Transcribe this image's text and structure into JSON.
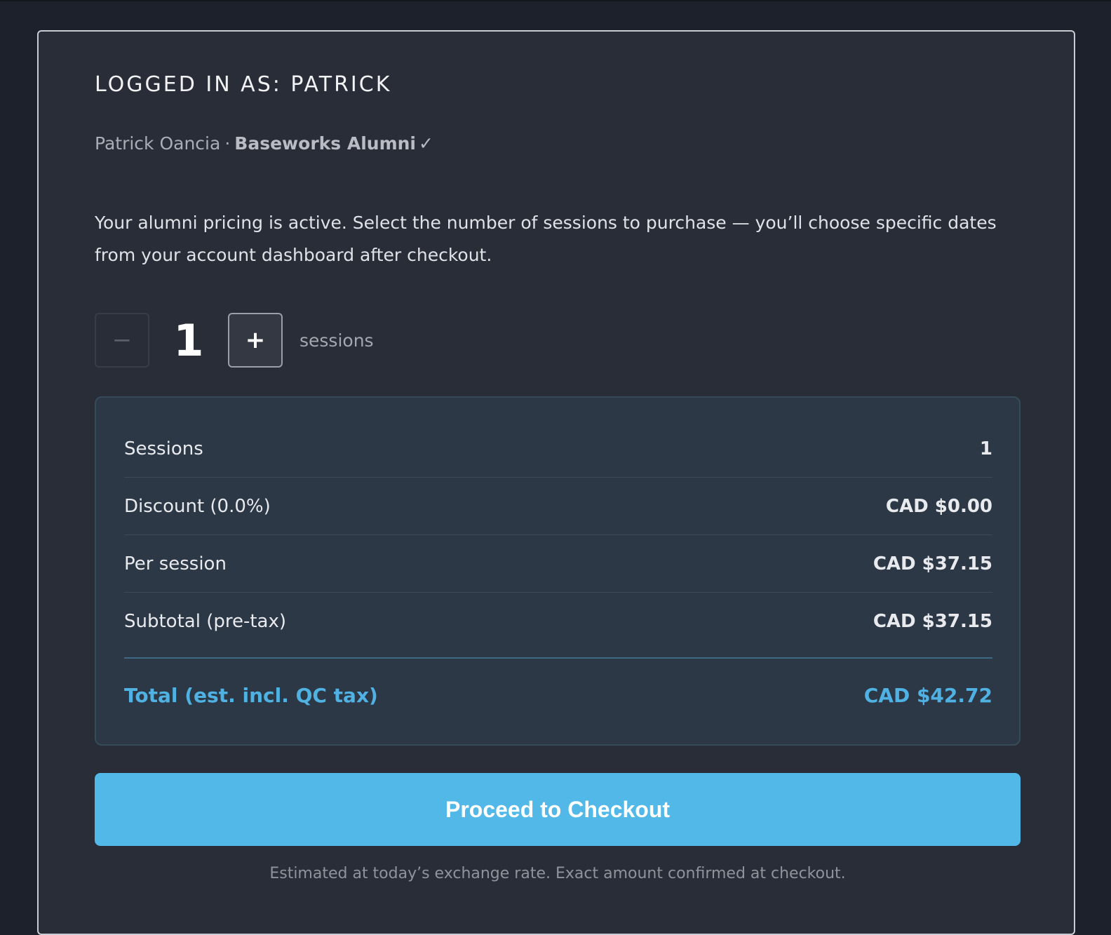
{
  "account": {
    "logged_in_label": "LOGGED IN AS: PATRICK",
    "full_name": "Patrick Oancia",
    "separator": "·",
    "membership": "Baseworks Alumni",
    "membership_check": "✓"
  },
  "intro_text": "Your alumni pricing is active. Select the number of sessions to purchase — you’ll choose specific dates from your account dashboard after checkout.",
  "stepper": {
    "decrement_label": "−",
    "quantity": "1",
    "increment_label": "+",
    "unit_label": "sessions"
  },
  "summary": {
    "rows": [
      {
        "label": "Sessions",
        "value": "1"
      },
      {
        "label": "Discount (0.0%)",
        "value": "CAD $0.00"
      },
      {
        "label": "Per session",
        "value": "CAD $37.15"
      },
      {
        "label": "Subtotal (pre-tax)",
        "value": "CAD $37.15"
      }
    ],
    "total_label": "Total (est. incl. QC tax)",
    "total_value": "CAD $42.72"
  },
  "checkout_button_label": "Proceed to Checkout",
  "footnote": "Estimated at today’s exchange rate. Exact amount confirmed at checkout.",
  "colors": {
    "accent": "#52b8e8",
    "total_text": "#4fb2e3",
    "card_bg": "#292d37",
    "summary_bg": "#2c3846"
  }
}
